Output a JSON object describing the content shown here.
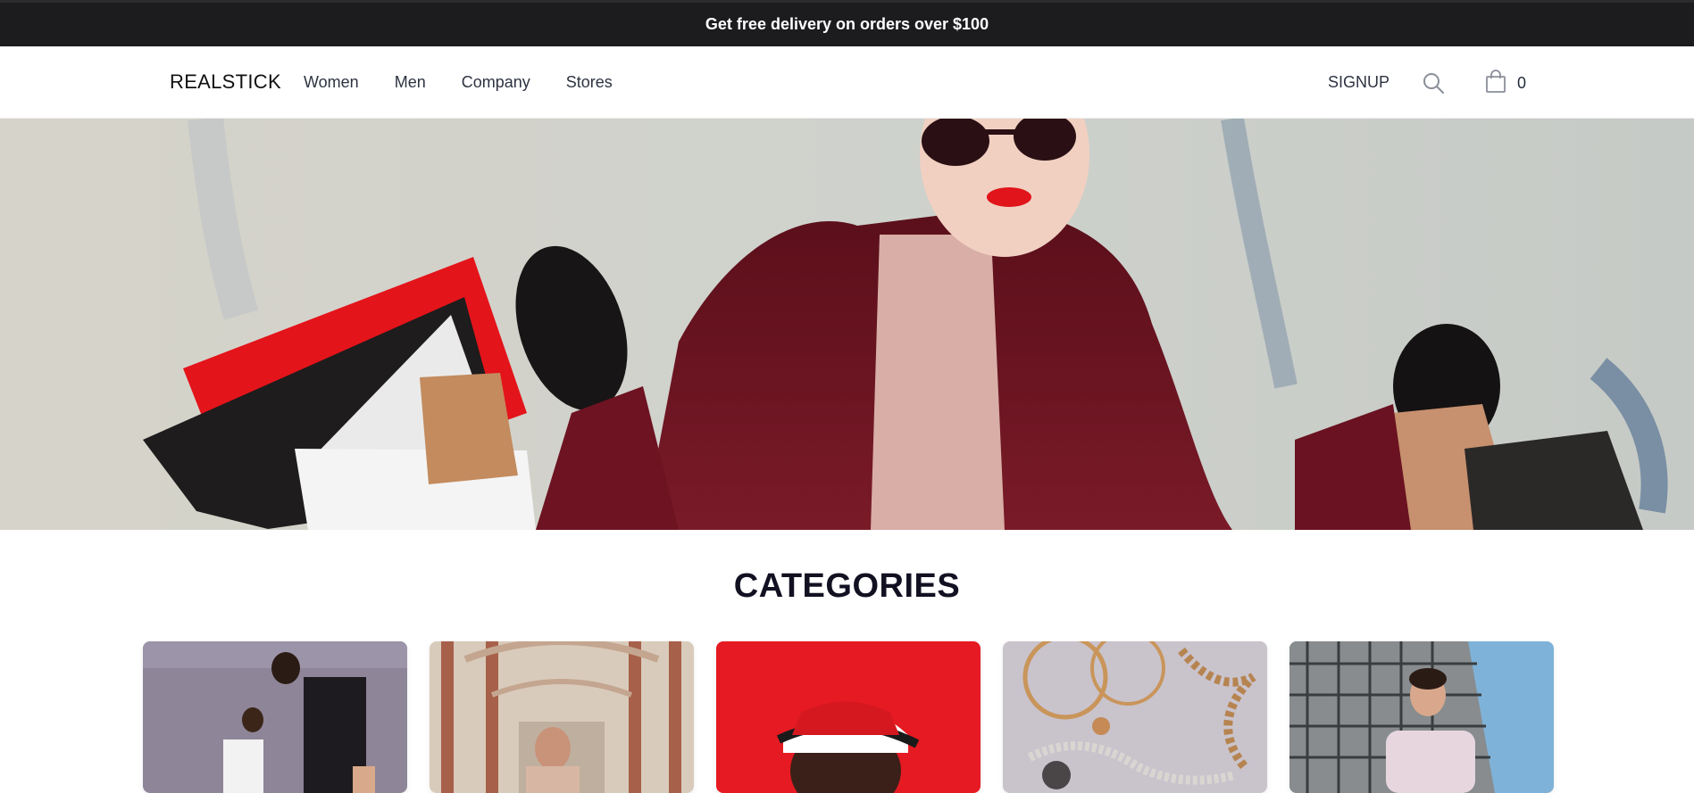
{
  "announcement": {
    "text": "Get free delivery on orders over $100"
  },
  "header": {
    "logo": "REALSTICK",
    "menu": [
      {
        "label": "Women"
      },
      {
        "label": "Men"
      },
      {
        "label": "Company"
      },
      {
        "label": "Stores"
      }
    ],
    "signup_label": "SIGNUP",
    "search_icon": "search-icon",
    "cart_icon": "shopping-bag-icon",
    "cart_count": "0"
  },
  "hero": {
    "image": "woman-with-shopping-bags"
  },
  "categories": {
    "title": "CATEGORIES",
    "cards": [
      {
        "image": "two-men-purple-wall"
      },
      {
        "image": "man-in-arcade"
      },
      {
        "image": "man-red-cap-red-background"
      },
      {
        "image": "gold-jewelry"
      },
      {
        "image": "man-pink-hoodie-building"
      }
    ]
  },
  "colors": {
    "announcement_bg": "#1c1c1f",
    "hero_coat": "#6e1522",
    "accent_red": "#e0141a"
  }
}
